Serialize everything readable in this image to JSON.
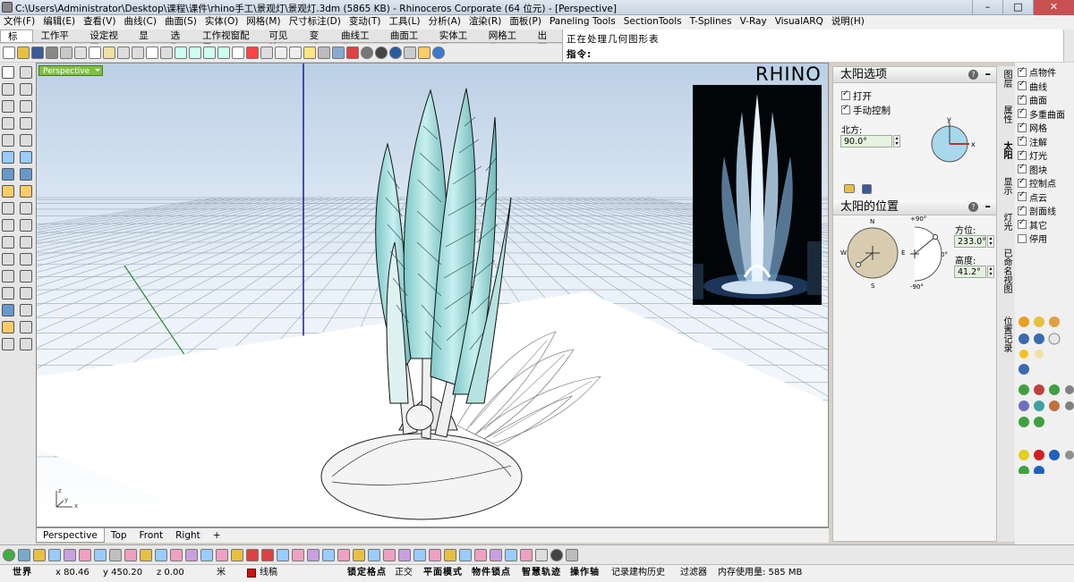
{
  "window": {
    "title": "C:\\Users\\Administrator\\Desktop\\课程\\课件\\rhino手工\\景观灯\\景观灯.3dm (5865 KB) - Rhinoceros Corporate (64 位元) - [Perspective]",
    "minimize": "–",
    "maximize": "□",
    "close": "✕"
  },
  "menu": [
    "文件(F)",
    "编辑(E)",
    "查看(V)",
    "曲线(C)",
    "曲面(S)",
    "实体(O)",
    "网格(M)",
    "尺寸标注(D)",
    "变动(T)",
    "工具(L)",
    "分析(A)",
    "渲染(R)",
    "面板(P)",
    "Paneling Tools",
    "SectionTools",
    "T-Splines",
    "V-Ray",
    "VisualARQ",
    "说明(H)"
  ],
  "toolbar_tabs": [
    "标准",
    "工作平面",
    "设定视图",
    "显示",
    "选取",
    "工作视窗配置",
    "可见性",
    "变动",
    "曲线工具",
    "曲面工具",
    "实体工具",
    "网格工具",
    "出图"
  ],
  "command": {
    "history": "正在处理几何图形表",
    "prompt": "指令:"
  },
  "viewport": {
    "label": "Perspective",
    "logo": "RHINO",
    "axis_x": "x",
    "axis_y": "y",
    "axis_z": "z"
  },
  "view_tabs": [
    "Perspective",
    "Top",
    "Front",
    "Right",
    "+"
  ],
  "sun_options": {
    "title": "太阳选项",
    "open_label": "打开",
    "manual_label": "手动控制",
    "north_label": "北方:",
    "north_value": "90.0°",
    "compass_x": "x",
    "compass_y": "y"
  },
  "sun_position": {
    "title": "太阳的位置",
    "azimuth_label": "方位:",
    "azimuth_value": "233.0°",
    "altitude_label": "高度:",
    "altitude_value": "41.2°",
    "dial_n": "N",
    "dial_s": "S",
    "dial_e": "E",
    "dial_w": "W",
    "alt_top": "+90°",
    "alt_mid": "0°",
    "alt_bottom": "-90°"
  },
  "side_tabs": [
    "图层",
    "属性",
    "太阳",
    "显示",
    "灯光",
    "已命名视图",
    "位置记录"
  ],
  "layers": [
    {
      "name": "点物件",
      "checked": true
    },
    {
      "name": "曲线",
      "checked": true
    },
    {
      "name": "曲面",
      "checked": true
    },
    {
      "name": "多重曲面",
      "checked": true
    },
    {
      "name": "网格",
      "checked": true
    },
    {
      "name": "注解",
      "checked": true
    },
    {
      "name": "灯光",
      "checked": true
    },
    {
      "name": "图块",
      "checked": true
    },
    {
      "name": "控制点",
      "checked": true
    },
    {
      "name": "点云",
      "checked": true
    },
    {
      "name": "剖面线",
      "checked": true
    },
    {
      "name": "其它",
      "checked": true
    },
    {
      "name": "停用",
      "checked": false
    }
  ],
  "status": {
    "world": "世界",
    "x": "x 80.46",
    "y": "y 450.20",
    "z": "z 0.00",
    "unit": "米",
    "layer": "线稿",
    "layer_color": "#d01010",
    "snaps": [
      "锁定格点",
      "正交",
      "平面模式",
      "物件锁点",
      "智慧轨迹",
      "操作轴",
      "记录建构历史",
      "过滤器"
    ],
    "memory": "内存使用量: 585 MB"
  },
  "colors": {
    "accent_green": "#7fbf3f",
    "glass": "#a8dede",
    "grid": "#9aa8b8"
  }
}
